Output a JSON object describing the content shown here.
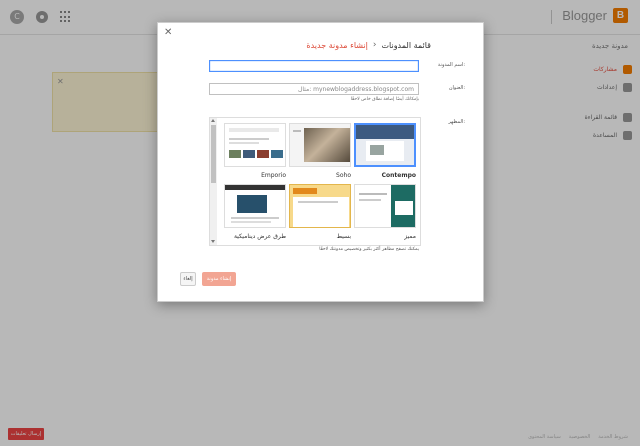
{
  "topbar": {
    "avatar_letter": "C",
    "brand": "Blogger",
    "brand_color": "#f57d00"
  },
  "sidebar": {
    "title": "مدونة جديدة",
    "items": [
      {
        "label": "مشاركات",
        "icon": "blogger-icon",
        "active": true
      },
      {
        "label": "إعدادات",
        "icon": "gear-icon",
        "active": false
      },
      {
        "label": "قائمة القراءة",
        "icon": "reading-list-icon",
        "active": false
      },
      {
        "label": "المساعدة",
        "icon": "help-icon",
        "active": false
      }
    ]
  },
  "dialog": {
    "breadcrumb_root": "قائمة المدونات",
    "breadcrumb_sep": "›",
    "breadcrumb_current": "إنشاء مدونة جديدة",
    "title_label": "اسم المدونة:",
    "title_value": "",
    "address_label": "العنوان:",
    "address_placeholder": "مثال: mynewblogaddress.blogspot.com",
    "address_hint": "بإمكانك أيضًا إضافة نطاق خاص لاحقًا",
    "theme_label": "المظهر:",
    "themes": [
      {
        "name": "Contempo",
        "selected": true
      },
      {
        "name": "Soho",
        "selected": false
      },
      {
        "name": "Emporio",
        "selected": false
      },
      {
        "name": "مميز",
        "selected": false
      },
      {
        "name": "بسيط",
        "selected": false
      },
      {
        "name": "طرق عرض ديناميكية",
        "selected": false
      }
    ],
    "theme_hint": "يمكنك تصفح مظاهر أكثر بكثير وتخصيص مدونتك لاحقًا",
    "create_button": "إنشاء مدونة",
    "cancel_button": "إلغاء",
    "accent_color": "#dd4b39",
    "focus_color": "#4d90fe"
  },
  "footer": {
    "feedback_button": "إرسال تعليقات",
    "links": [
      "شروط الخدمة",
      "الخصوصية",
      "سياسة المحتوى"
    ]
  }
}
